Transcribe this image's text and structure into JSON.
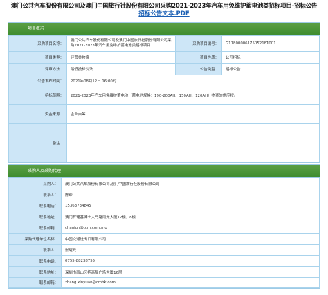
{
  "page": {
    "title": "澳门公共汽车股份有限公司及澳门中国旅行社股份有限公司采购2021-2023年汽车用免维护蓄电池类招标项目-招标公告",
    "pdf_link": "招标公告文本.PDF"
  },
  "project": {
    "header": "项目概况",
    "rows": {
      "purchase_name_label": "采购项目名称：",
      "purchase_name_value": "澳门公共汽车股份有限公司及澳门中国旅行社股份有限公司采购2021-2023年汽车用免维护蓄电池类招标项目",
      "project_no_label": "采购项目编号：",
      "project_no_value": "G1180000617505218T001",
      "project_type_label": "项目类型：",
      "project_type_value": "经营类物资",
      "project_property_label": "项目性质：",
      "project_property_value": "公开招标",
      "review_method_label": "评审方法：",
      "review_method_value": "最低投标价法",
      "notice_type_label": "公告类型：",
      "notice_type_value": "招标公告",
      "publish_time_label": "公告发布时间：",
      "publish_time_value": "2021年08月12日 16:00时",
      "scope_label": "招标范围：",
      "scope_value": "2021-2023年汽车用免维护蓄电池（蓄电池规格：190-200AH、150AH、120AH）物资的供应权。",
      "funding_label": "资金来源：",
      "funding_value": "企业自筹",
      "remarks_label": "备注：",
      "remarks_value": ""
    }
  },
  "agency": {
    "header": "采购人及采购代理",
    "rows": {
      "purchaser_label": "采购人：",
      "purchaser_value": "澳门公共汽车股份有限公司,澳门中国旅行社股份有限公司",
      "contact_label": "联系人：",
      "contact_value": "陈帮",
      "phone_label": "联系电话：",
      "phone_value": "15363734845",
      "address_label": "联系地址：",
      "address_value": "澳门罗理基博士大马路南光大厦12楼，8楼",
      "email_label": "联系邮箱：",
      "email_value": "chanjun@tcm.com.mo",
      "agent_label": "采购代理单位名称：",
      "agent_value": "中国交通进出口有限公司",
      "agent_contact_label": "联系人：",
      "agent_contact_value": "张曜元",
      "agent_phone_label": "联系电话：",
      "agent_phone_value": "0755-88238755",
      "agent_address_label": "联系地址：",
      "agent_address_value": "深圳市南山区招商局广场大厦16层",
      "agent_email_label": "联系邮箱：",
      "agent_email_value": "zhang.xinyuan@cmhk.com"
    }
  }
}
